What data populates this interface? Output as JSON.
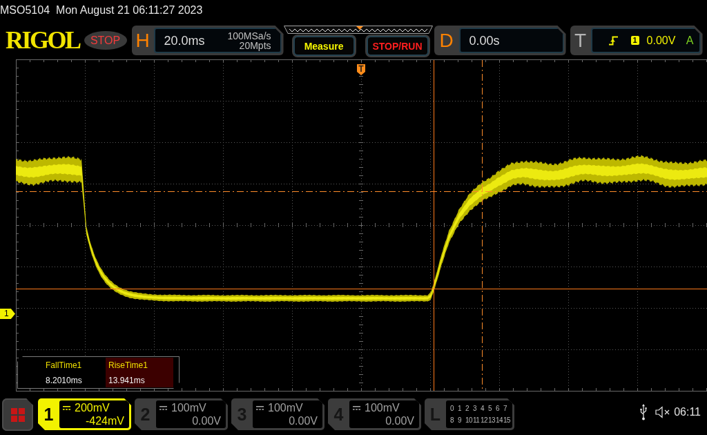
{
  "status_line": {
    "model": "MSO5104",
    "datetime": "Mon August 21 06:11:27 2023"
  },
  "header": {
    "logo": "RIGOL",
    "run_state": {
      "label": "STOP",
      "kind": "stop"
    },
    "horizontal": {
      "label": "H",
      "timebase": "20.0ms",
      "sample_rate": "100MSa/s",
      "memory_depth": "20Mpts"
    },
    "buttons": [
      {
        "label": "Measure",
        "kind": "measure"
      },
      {
        "label": "STOP/RUN",
        "kind": "run_control"
      }
    ],
    "delay": {
      "label": "D",
      "value": "0.00s"
    },
    "trigger": {
      "label": "T",
      "source": "1",
      "level": "0.00V",
      "mode": "A"
    }
  },
  "display": {
    "channel_marker": "1",
    "measurements": [
      {
        "name": "FallTime1",
        "value": "8.2010ms",
        "selected": false
      },
      {
        "name": "RiseTime1",
        "value": "13.941ms",
        "selected": true
      }
    ]
  },
  "channels": [
    {
      "number": "1",
      "scale": "200mV",
      "offset": "-424mV",
      "on": true
    },
    {
      "number": "2",
      "scale": "100mV",
      "offset": "0.00V",
      "on": false
    },
    {
      "number": "3",
      "scale": "100mV",
      "offset": "0.00V",
      "on": false
    },
    {
      "number": "4",
      "scale": "100mV",
      "offset": "0.00V",
      "on": false
    }
  ],
  "logic": {
    "label": "L",
    "rows": [
      [
        "0",
        "1",
        "2",
        "3",
        "4",
        "5",
        "6",
        "7"
      ],
      [
        "8",
        "9",
        "10",
        "11",
        "12",
        "13",
        "14",
        "15"
      ]
    ]
  },
  "status_bar": {
    "time": "06:11"
  }
}
